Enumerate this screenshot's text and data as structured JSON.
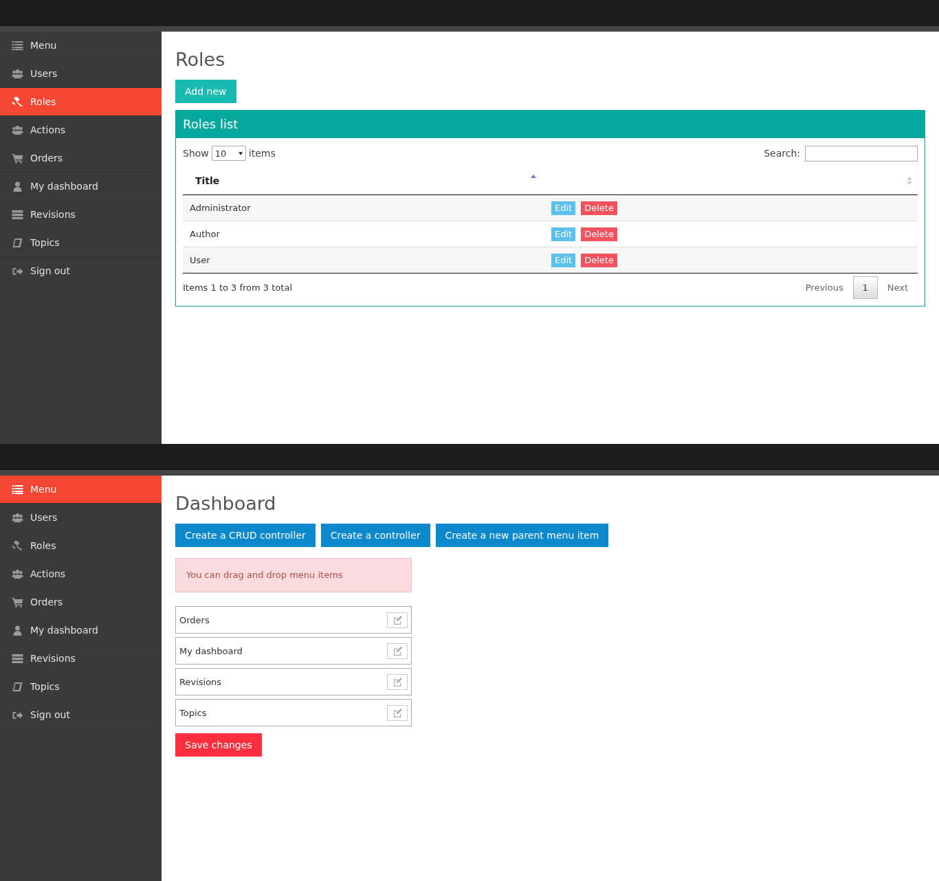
{
  "roles_screen": {
    "sidebar": {
      "items": [
        {
          "label": "Menu",
          "kind": "list",
          "selected": false
        },
        {
          "label": "Users",
          "kind": "users",
          "selected": false
        },
        {
          "label": "Roles",
          "kind": "gavel",
          "selected": true
        },
        {
          "label": "Actions",
          "kind": "users",
          "selected": false
        },
        {
          "label": "Orders",
          "kind": "cart",
          "selected": false
        },
        {
          "label": "My dashboard",
          "kind": "user",
          "selected": false
        },
        {
          "label": "Revisions",
          "kind": "server",
          "selected": false
        },
        {
          "label": "Topics",
          "kind": "book",
          "selected": false
        },
        {
          "label": "Sign out",
          "kind": "signout",
          "selected": false
        }
      ]
    },
    "page_title": "Roles",
    "add_button": "Add new",
    "panel": {
      "title": "Roles list",
      "show_label": "Show",
      "page_size": "10",
      "items_label": "items",
      "search_label": "Search:",
      "columns": [
        {
          "label": "Title",
          "sorted": true
        },
        {
          "sorted": false
        }
      ],
      "rows": [
        {
          "title": "Administrator",
          "actions": [
            {
              "label": "Edit",
              "kind": "edit"
            },
            {
              "label": "Delete",
              "kind": "delete"
            }
          ]
        },
        {
          "title": "Author",
          "actions": [
            {
              "label": "Edit",
              "kind": "edit"
            },
            {
              "label": "Delete",
              "kind": "delete"
            }
          ]
        },
        {
          "title": "User",
          "actions": [
            {
              "label": "Edit",
              "kind": "edit"
            },
            {
              "label": "Delete",
              "kind": "delete"
            }
          ]
        }
      ],
      "summary": "Items 1 to 3 from 3 total",
      "pagination": {
        "previous": "Previous",
        "pages": [
          {
            "label": "1",
            "selected": true
          }
        ],
        "next": "Next"
      }
    }
  },
  "dashboard_screen": {
    "sidebar": {
      "items": [
        {
          "label": "Menu",
          "kind": "list",
          "selected": true
        },
        {
          "label": "Users",
          "kind": "users",
          "selected": false
        },
        {
          "label": "Roles",
          "kind": "gavel",
          "selected": false
        },
        {
          "label": "Actions",
          "kind": "users",
          "selected": false
        },
        {
          "label": "Orders",
          "kind": "cart",
          "selected": false
        },
        {
          "label": "My dashboard",
          "kind": "user",
          "selected": false
        },
        {
          "label": "Revisions",
          "kind": "server",
          "selected": false
        },
        {
          "label": "Topics",
          "kind": "book",
          "selected": false
        },
        {
          "label": "Sign out",
          "kind": "signout",
          "selected": false
        }
      ]
    },
    "page_title": "Dashboard",
    "buttons": [
      "Create a CRUD controller",
      "Create a controller",
      "Create a new parent menu item"
    ],
    "alert": "You can drag and drop menu items",
    "menu_items": [
      "Orders",
      "My dashboard",
      "Revisions",
      "Topics"
    ],
    "save_button": "Save changes"
  }
}
